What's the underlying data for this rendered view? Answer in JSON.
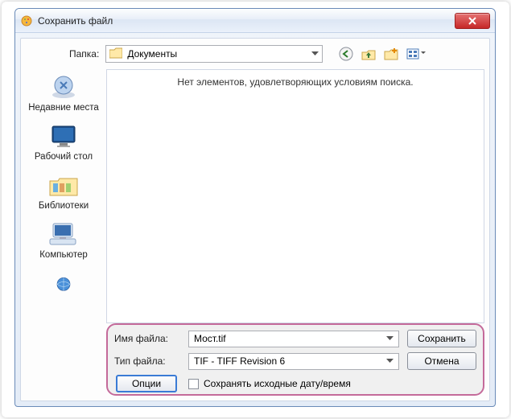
{
  "window": {
    "title": "Сохранить файл"
  },
  "toprow": {
    "folder_label": "Папка:",
    "folder_value": "Документы"
  },
  "sidebar": {
    "items": [
      {
        "label": "Недавние места"
      },
      {
        "label": "Рабочий стол"
      },
      {
        "label": "Библиотеки"
      },
      {
        "label": "Компьютер"
      },
      {
        "label": ""
      }
    ]
  },
  "listarea": {
    "empty_text": "Нет элементов, удовлетворяющих условиям поиска."
  },
  "bottom": {
    "filename_label": "Имя файла:",
    "filename_value": "Мост.tif",
    "filetype_label": "Тип файла:",
    "filetype_value": "TIF - TIFF Revision 6",
    "save_label": "Сохранить",
    "cancel_label": "Отмена",
    "options_label": "Опции",
    "preserve_date_label": "Сохранять исходные дату/время",
    "preserve_date_checked": false
  },
  "colors": {
    "highlight_border": "#c46a9a"
  }
}
